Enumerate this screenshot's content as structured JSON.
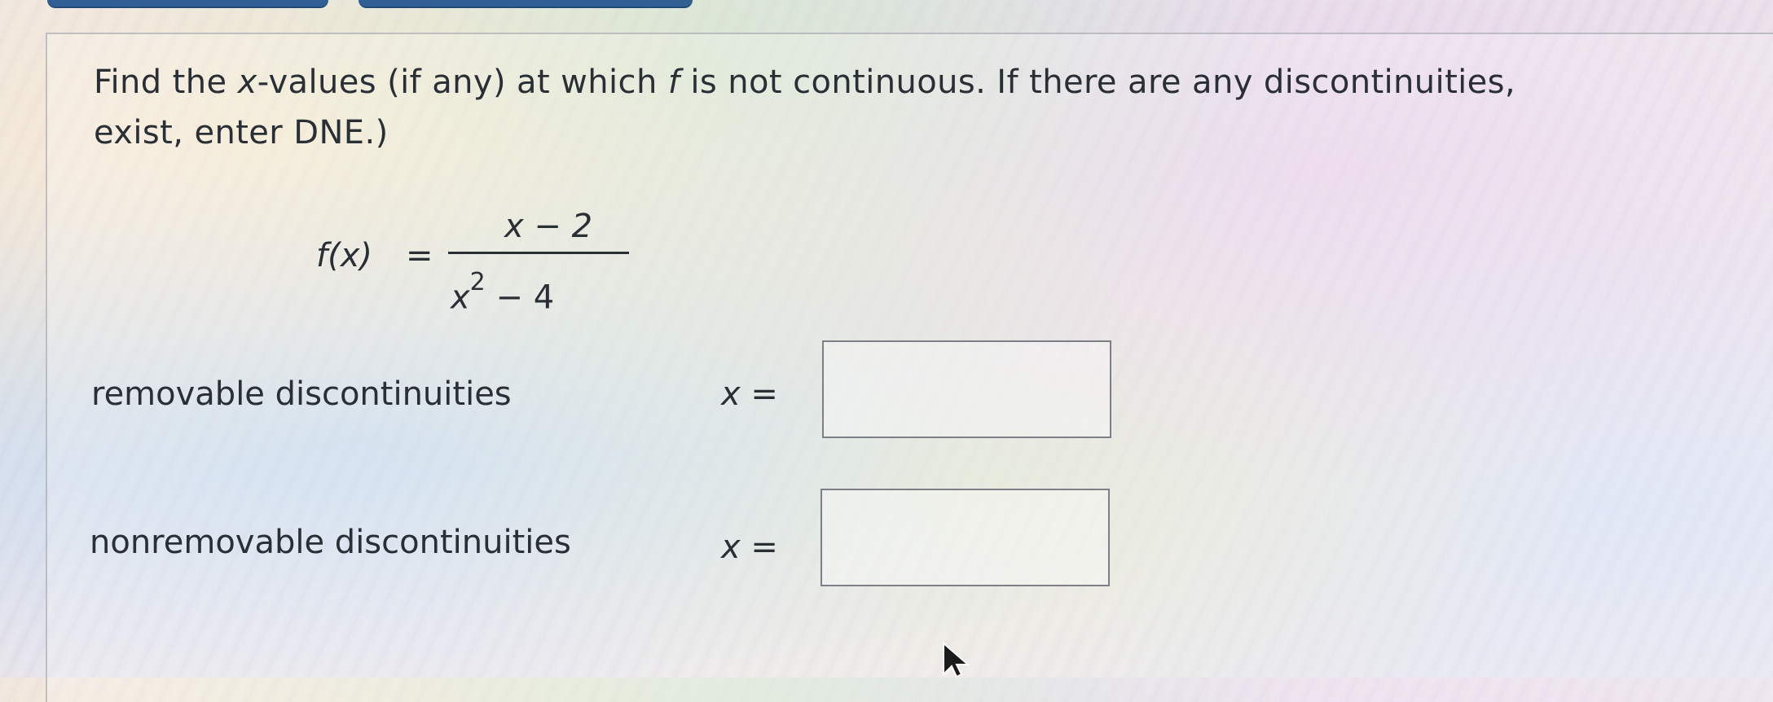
{
  "question": {
    "line1_a": "Find the ",
    "line1_var": "x",
    "line1_b": "-values (if any) at which ",
    "line1_f": "f",
    "line1_c": " is not continuous. If there are any discontinuities, ",
    "line2": "exist, enter DNE.)"
  },
  "formula": {
    "lhs": "f(x)",
    "equals": "=",
    "numerator": "x − 2",
    "denominator_base": "x",
    "denominator_exp": "2",
    "denominator_rest": " − 4"
  },
  "answers": {
    "removable": {
      "label": "removable discontinuities",
      "x_label": "x =",
      "value": ""
    },
    "nonremovable": {
      "label": "nonremovable discontinuities",
      "x_label": "x =",
      "value": ""
    }
  },
  "icons": {
    "cursor": "mouse-pointer-icon"
  }
}
